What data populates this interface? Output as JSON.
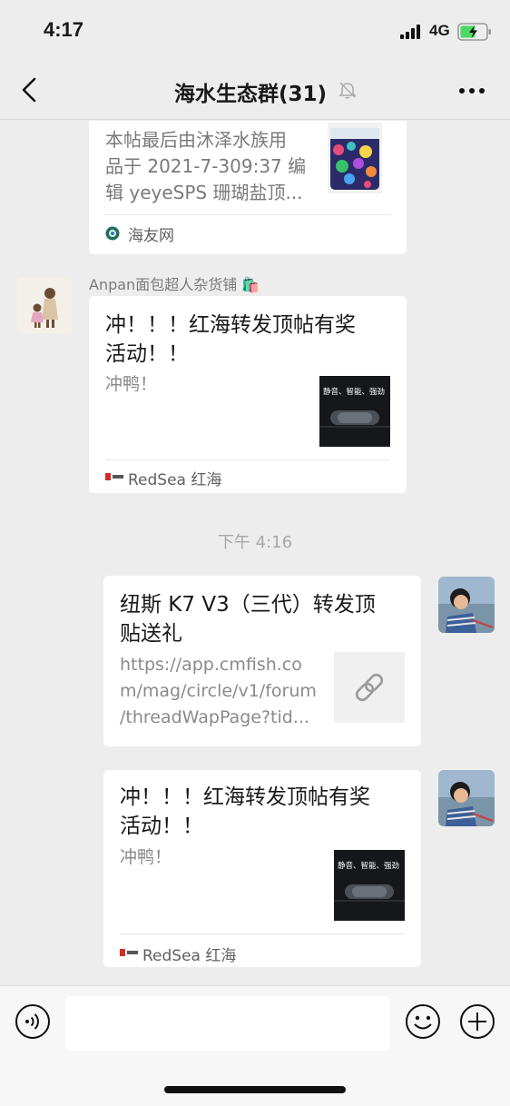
{
  "status_bar": {
    "time": "4:17",
    "network": "4G"
  },
  "header": {
    "title": "海水生态群(31)"
  },
  "messages": [
    {
      "desc": "本帖最后由沐泽水族用品于 2021-7-309:37 编辑 yeyeSPS 珊瑚盐顶...",
      "desc_lines": [
        "本帖最后由沐泽水族用",
        "品于 2021-7-309:37 编",
        "辑 yeyeSPS 珊瑚盐顶..."
      ],
      "source": "海友网"
    },
    {
      "sender": "Anpan面包超人杂货铺 🛍️",
      "title_lines": [
        "冲！！！红海转发顶帖有奖",
        "活动！！"
      ],
      "desc": "冲鸭！",
      "thumb_text": "静音、智能、强劲",
      "source": "RedSea 红海"
    },
    {
      "timestamp": "下午 4:16"
    },
    {
      "title_lines": [
        "纽斯 K7 V3（三代）转发顶",
        "贴送礼"
      ],
      "desc_lines": [
        "https://app.cmfish.co",
        "m/mag/circle/v1/forum",
        "/threadWapPage?tid..."
      ]
    },
    {
      "title_lines": [
        "冲！！！红海转发顶帖有奖",
        "活动！！"
      ],
      "desc": "冲鸭！",
      "thumb_text": "静音、智能、强劲",
      "source": "RedSea 红海"
    }
  ],
  "colors": {
    "background": "#ededed",
    "card": "#ffffff",
    "secondary_text": "#888888",
    "timestamp": "#a8a8a8"
  },
  "icons": [
    "back-chevron-icon",
    "mute-bell-icon",
    "more-dots-icon",
    "voice-icon",
    "emoji-icon",
    "plus-icon",
    "link-icon"
  ]
}
